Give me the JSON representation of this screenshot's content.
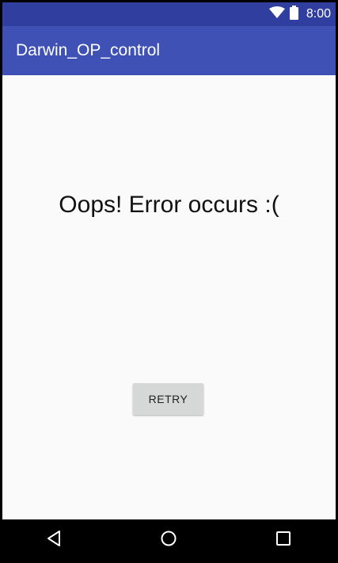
{
  "status_bar": {
    "time": "8:00",
    "icons": [
      "wifi-icon",
      "battery-icon"
    ]
  },
  "app_bar": {
    "title": "Darwin_OP_control",
    "color": "#3f51b5",
    "status_color": "#303f9f"
  },
  "main": {
    "error_message": "Oops! Error occurs :(",
    "retry_label": "RETRY"
  },
  "nav_bar": {
    "buttons": [
      "back-icon",
      "home-icon",
      "recents-icon"
    ]
  }
}
